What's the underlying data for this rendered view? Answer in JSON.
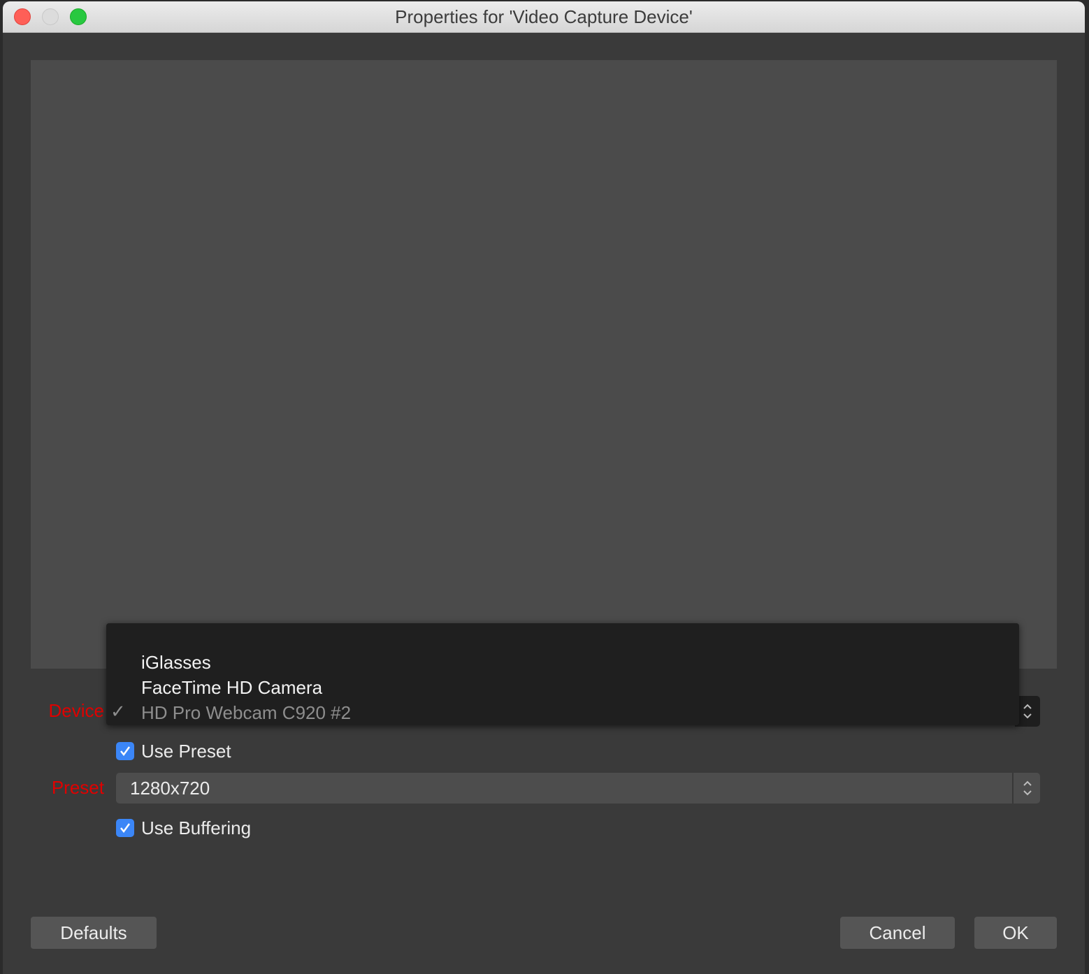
{
  "window": {
    "title": "Properties for 'Video Capture Device'"
  },
  "device": {
    "label": "Device",
    "options": [
      "iGlasses",
      "FaceTime HD Camera",
      "HD Pro Webcam C920 #2"
    ],
    "selected_index": 2,
    "check_glyph": "✓"
  },
  "use_preset": {
    "label": "Use Preset",
    "checked": true
  },
  "preset": {
    "label": "Preset",
    "value": "1280x720"
  },
  "use_buffering": {
    "label": "Use Buffering",
    "checked": true
  },
  "buttons": {
    "defaults": "Defaults",
    "cancel": "Cancel",
    "ok": "OK"
  },
  "colors": {
    "accent": "#3b86f7",
    "label_red": "#e00000",
    "close": "#fe5f57",
    "maximize": "#28c840"
  },
  "icons": {
    "stepper": "up-down-chevron-icon",
    "checkmark": "checkmark-icon"
  }
}
